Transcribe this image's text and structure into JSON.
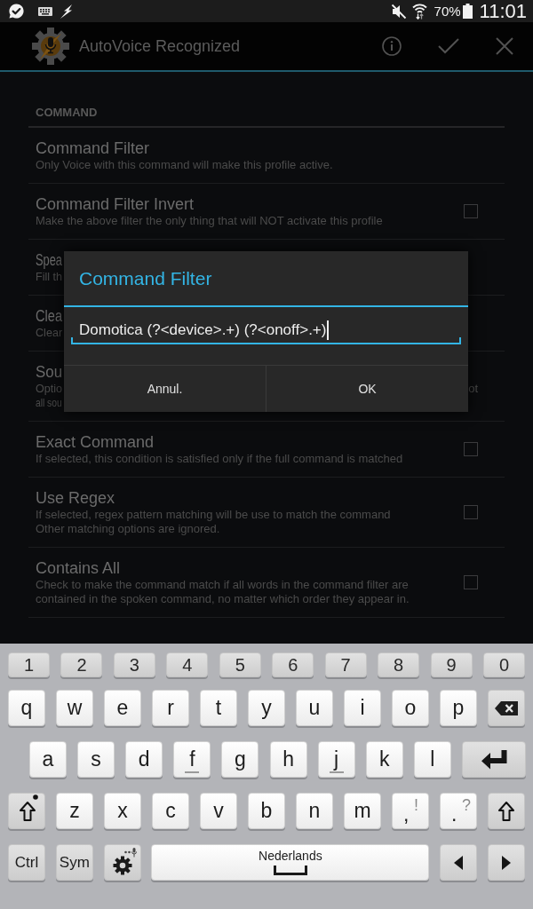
{
  "status_bar": {
    "battery": "70%",
    "time": "11:01"
  },
  "action_bar": {
    "title": "AutoVoice Recognized"
  },
  "preferences": {
    "section": "COMMAND",
    "items": [
      {
        "kind": "plain",
        "title": "Command Filter",
        "summary": [
          "Only Voice with this command will make this profile active."
        ]
      },
      {
        "kind": "checkbox",
        "title": "Command Filter Invert",
        "summary": [
          "Make the above filter the only thing that will NOT activate this profile"
        ],
        "checked": false
      },
      {
        "kind": "covered",
        "title": "Spea",
        "summary": [
          "Fill th"
        ]
      },
      {
        "kind": "covered",
        "title": "Clea",
        "summary": [
          "Clear"
        ]
      },
      {
        "kind": "covered",
        "title": "Sou",
        "summary": [
          "Optio",
          "all sou"
        ],
        "tail": "ot"
      },
      {
        "kind": "checkbox",
        "title": "Exact Command",
        "summary": [
          "If selected, this condition is satisfied only if the full command is matched"
        ],
        "checked": false
      },
      {
        "kind": "checkbox",
        "title": "Use Regex",
        "summary": [
          "If selected, regex pattern matching will be use to match the command",
          "Other matching options are ignored."
        ],
        "checked": false
      },
      {
        "kind": "checkbox",
        "title": "Contains All",
        "summary": [
          "Check to make the command match if all words in the command filter are",
          "contained in the spoken command, no matter which order they appear in."
        ],
        "checked": false
      }
    ]
  },
  "dialog": {
    "title": "Command Filter",
    "value": "Domotica (?<device>.+) (?<onoff>.+)",
    "buttons": [
      "Annul.",
      "OK"
    ]
  },
  "keyboard": {
    "rows": [
      {
        "keys": [
          {
            "kind": "number",
            "label": "1"
          },
          {
            "kind": "number",
            "label": "2"
          },
          {
            "kind": "number",
            "label": "3"
          },
          {
            "kind": "number",
            "label": "4"
          },
          {
            "kind": "number",
            "label": "5"
          },
          {
            "kind": "number",
            "label": "6"
          },
          {
            "kind": "number",
            "label": "7"
          },
          {
            "kind": "number",
            "label": "8"
          },
          {
            "kind": "number",
            "label": "9"
          },
          {
            "kind": "number",
            "label": "0"
          }
        ]
      },
      {
        "keys": [
          {
            "kind": "letter",
            "label": "q"
          },
          {
            "kind": "letter",
            "label": "w"
          },
          {
            "kind": "letter",
            "label": "e"
          },
          {
            "kind": "letter",
            "label": "r"
          },
          {
            "kind": "letter",
            "label": "t"
          },
          {
            "kind": "letter",
            "label": "y"
          },
          {
            "kind": "letter",
            "label": "u"
          },
          {
            "kind": "letter",
            "label": "i"
          },
          {
            "kind": "letter",
            "label": "o"
          },
          {
            "kind": "letter",
            "label": "p"
          },
          {
            "kind": "backspace"
          }
        ]
      },
      {
        "keys": [
          {
            "kind": "letter",
            "label": "a"
          },
          {
            "kind": "letter",
            "label": "s"
          },
          {
            "kind": "letter",
            "label": "d"
          },
          {
            "kind": "homing",
            "label": "f"
          },
          {
            "kind": "letter",
            "label": "g"
          },
          {
            "kind": "letter",
            "label": "h"
          },
          {
            "kind": "homing",
            "label": "j"
          },
          {
            "kind": "letter",
            "label": "k"
          },
          {
            "kind": "letter",
            "label": "l"
          },
          {
            "kind": "enter"
          }
        ]
      },
      {
        "keys": [
          {
            "kind": "shift",
            "indicator": true
          },
          {
            "kind": "letter",
            "label": "z"
          },
          {
            "kind": "letter",
            "label": "x"
          },
          {
            "kind": "letter",
            "label": "c"
          },
          {
            "kind": "letter",
            "label": "v"
          },
          {
            "kind": "letter",
            "label": "b"
          },
          {
            "kind": "letter",
            "label": "n"
          },
          {
            "kind": "letter",
            "label": "m"
          },
          {
            "kind": "dual",
            "label": ",",
            "alt": "!"
          },
          {
            "kind": "dual",
            "label": ".",
            "alt": "?"
          },
          {
            "kind": "shift",
            "indicator": false
          }
        ]
      },
      {
        "keys": [
          {
            "kind": "function",
            "label": "Ctrl"
          },
          {
            "kind": "function",
            "label": "Sym"
          },
          {
            "kind": "settings"
          },
          {
            "kind": "space",
            "label": "Nederlands"
          },
          {
            "kind": "left"
          },
          {
            "kind": "right"
          }
        ]
      }
    ]
  }
}
